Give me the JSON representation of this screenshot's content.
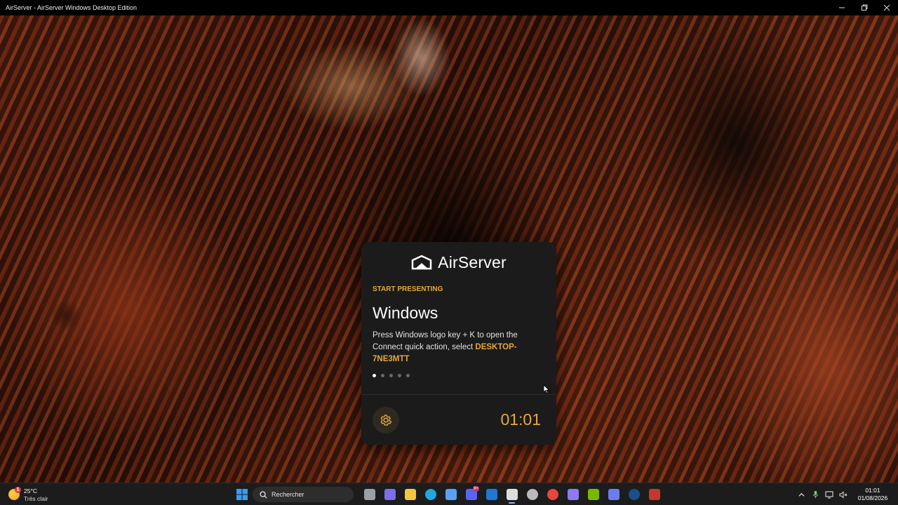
{
  "window": {
    "title": "AirServer - AirServer Windows Desktop Edition",
    "controls": [
      "minimize",
      "restore",
      "close"
    ]
  },
  "colors": {
    "accent": "#e3a93a",
    "card_bg": "#1b1b1b",
    "taskbar_bg": "#1c1c1c"
  },
  "card": {
    "logo_text": "AirServer",
    "eyebrow": "START PRESENTING",
    "heading": "Windows",
    "description": "Press Windows logo key + K to open the Connect quick action, select ",
    "device_name": "DESKTOP-7NE3MTT",
    "pagination": {
      "total": 5,
      "active_index": 0
    },
    "settings_icon": "gear-icon",
    "clock": "01:01"
  },
  "taskbar": {
    "weather": {
      "temp": "25°C",
      "condition": "Très clair",
      "badge": "1"
    },
    "search_placeholder": "Rechercher",
    "apps": [
      {
        "name": "task-view",
        "color": "#9aa0a6"
      },
      {
        "name": "copilot",
        "color": "#7b6cf0"
      },
      {
        "name": "file-explorer",
        "color": "#f4c542"
      },
      {
        "name": "edge",
        "color": "#1fa8e0"
      },
      {
        "name": "microsoft-store",
        "color": "#5aa0f0"
      },
      {
        "name": "discord",
        "color": "#5865f2",
        "badge": "9+"
      },
      {
        "name": "outlook",
        "color": "#1f78d1"
      },
      {
        "name": "airserver",
        "color": "#dddddd",
        "active": true
      },
      {
        "name": "recording-app",
        "color": "#bbbbbb"
      },
      {
        "name": "chrome",
        "color": "#e8453c"
      },
      {
        "name": "game-controller",
        "color": "#8a7cf0"
      },
      {
        "name": "nvidia-app",
        "color": "#76b900"
      },
      {
        "name": "discord-2",
        "color": "#6d7bf0"
      },
      {
        "name": "steam",
        "color": "#1b4f8a"
      },
      {
        "name": "mixer-app",
        "color": "#c0392b"
      }
    ],
    "clock_time": "01:01",
    "clock_date": "01/08/2026"
  }
}
